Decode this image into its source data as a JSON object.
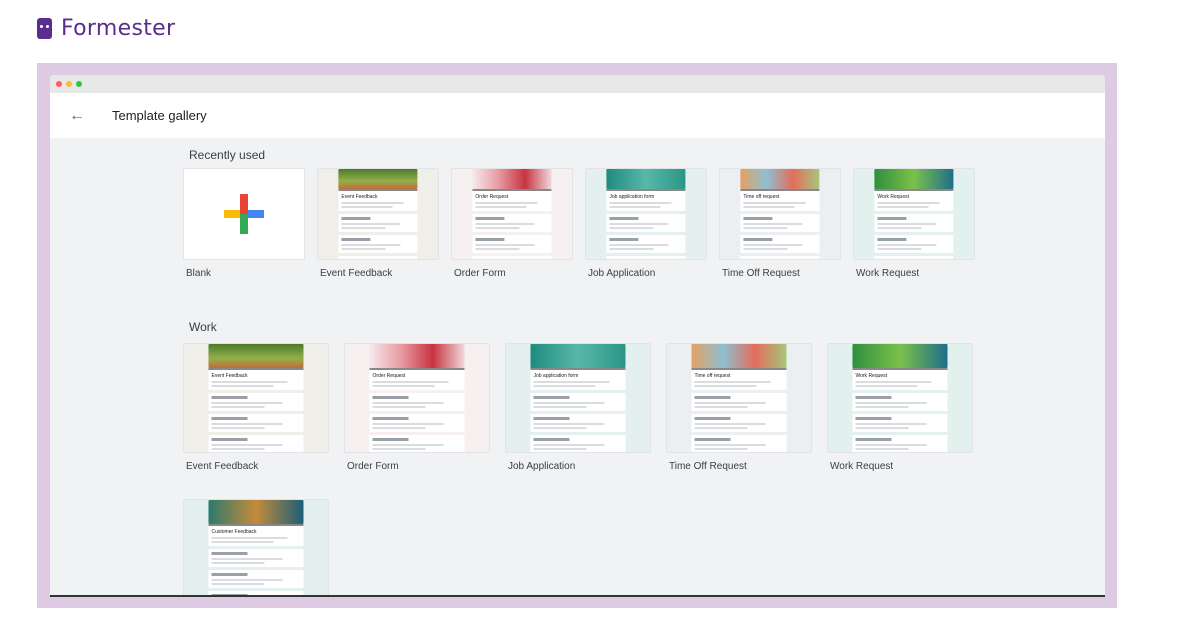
{
  "brand": {
    "name": "Formester"
  },
  "window": {
    "title": "Template gallery"
  },
  "sections": {
    "recent": {
      "title": "Recently used",
      "items": [
        {
          "label": "Blank",
          "banner": "",
          "bg": "#ffffff",
          "header": ""
        },
        {
          "label": "Event Feedback",
          "banner": "linear-gradient(180deg,#4f7a2b,#93b04a 60%,#c26b3a)",
          "bg": "#efeee8",
          "header": "Event Feedback"
        },
        {
          "label": "Order Form",
          "banner": "linear-gradient(90deg,#f7e9ec,#e89aa3,#c7343f,#f2d7dc)",
          "bg": "#f6f0f0",
          "header": "Order Request"
        },
        {
          "label": "Job Application",
          "banner": "linear-gradient(90deg,#1f8a80,#58b8a8,#2b9585)",
          "bg": "#e4f0ef",
          "header": "Job application form"
        },
        {
          "label": "Time Off Request",
          "banner": "linear-gradient(90deg,#e4a064,#8fbfd0,#e36d5c,#a6c77a)",
          "bg": "#eceff2",
          "header": "Time off request"
        },
        {
          "label": "Work Request",
          "banner": "linear-gradient(90deg,#2f8f3e,#7cc04a,#1d6f8a)",
          "bg": "#e2f0ee",
          "header": "Work Request"
        }
      ]
    },
    "work": {
      "title": "Work",
      "items": [
        {
          "label": "Event Feedback",
          "banner": "linear-gradient(180deg,#4f7a2b,#93b04a 60%,#c26b3a)",
          "bg": "#efeee8",
          "header": "Event Feedback"
        },
        {
          "label": "Order Form",
          "banner": "linear-gradient(90deg,#f7e9ec,#e89aa3,#c7343f,#f2d7dc)",
          "bg": "#f6f0f0",
          "header": "Order Request"
        },
        {
          "label": "Job Application",
          "banner": "linear-gradient(90deg,#1f8a80,#58b8a8,#2b9585)",
          "bg": "#e4f0ef",
          "header": "Job application form"
        },
        {
          "label": "Time Off Request",
          "banner": "linear-gradient(90deg,#e4a064,#8fbfd0,#e36d5c,#a6c77a)",
          "bg": "#eceff2",
          "header": "Time off request"
        },
        {
          "label": "Work Request",
          "banner": "linear-gradient(90deg,#2f8f3e,#7cc04a,#1d6f8a)",
          "bg": "#e2f0ee",
          "header": "Work Request"
        },
        {
          "label": "",
          "banner": "linear-gradient(90deg,#2c7a6e,#c48a3a,#1b5f78)",
          "bg": "#e4f0ef",
          "header": "Customer Feedback"
        }
      ]
    }
  },
  "colors": {
    "brand": "#5b2d8e",
    "frame": "#dccbe3",
    "traffic_red": "#ff5f57",
    "traffic_yellow": "#febc2e",
    "traffic_green": "#28c840"
  },
  "icons": {
    "back": "arrow-left-icon",
    "plus": "plus-icon"
  }
}
